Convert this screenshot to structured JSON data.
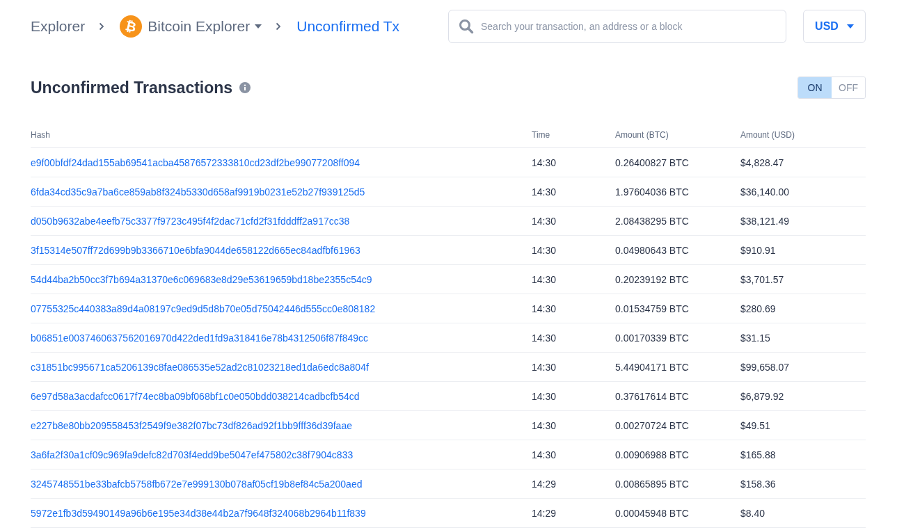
{
  "breadcrumb": [
    {
      "kind": "link",
      "label": "Explorer"
    },
    {
      "kind": "dropdown",
      "label": "Bitcoin Explorer",
      "logo": "₿"
    },
    {
      "kind": "current",
      "label": "Unconfirmed Tx"
    }
  ],
  "search": {
    "placeholder": "Search your transaction, an address or a block"
  },
  "currency": {
    "label": "USD"
  },
  "title": "Unconfirmed Transactions",
  "toggle": [
    {
      "label": "ON",
      "selected": true
    },
    {
      "label": "OFF",
      "selected": false
    }
  ],
  "table": {
    "columns": [
      "Hash",
      "Time",
      "Amount (BTC)",
      "Amount (USD)"
    ],
    "rows": [
      [
        "e9f00bfdf24dad155ab69541acba45876572333810cd23df2be99077208ff094",
        "14:30",
        "0.26400827 BTC",
        "$4,828.47"
      ],
      [
        "6fda34cd35c9a7ba6ce859ab8f324b5330d658af9919b0231e52b27f939125d5",
        "14:30",
        "1.97604036 BTC",
        "$36,140.00"
      ],
      [
        "d050b9632abe4eefb75c3377f9723c495f4f2dac71cfd2f31fdddff2a917cc38",
        "14:30",
        "2.08438295 BTC",
        "$38,121.49"
      ],
      [
        "3f15314e507ff72d699b9b3366710e6bfa9044de658122d665ec84adfbf61963",
        "14:30",
        "0.04980643 BTC",
        "$910.91"
      ],
      [
        "54d44ba2b50cc3f7b694a31370e6c069683e8d29e53619659bd18be2355c54c9",
        "14:30",
        "0.20239192 BTC",
        "$3,701.57"
      ],
      [
        "07755325c440383a89d4a08197c9ed9d5d8b70e05d75042446d555cc0e808182",
        "14:30",
        "0.01534759 BTC",
        "$280.69"
      ],
      [
        "b06851e0037460637562016970d422ded1fd9a318416e78b4312506f87f849cc",
        "14:30",
        "0.00170339 BTC",
        "$31.15"
      ],
      [
        "c31851bc995671ca5206139c8fae086535e52ad2c81023218ed1da6edc8a804f",
        "14:30",
        "5.44904171 BTC",
        "$99,658.07"
      ],
      [
        "6e97d58a3acdafcc0617f74ec8ba09bf068bf1c0e050bdd038214cadbcfb54cd",
        "14:30",
        "0.37617614 BTC",
        "$6,879.92"
      ],
      [
        "e227b8e80bb209558453f2549f9e382f07bc73df826ad92f1bb9fff36d39faae",
        "14:30",
        "0.00270724 BTC",
        "$49.51"
      ],
      [
        "3a6fa2f30a1cf09c969fa9defc82d703f4edd9be5047ef475802c38f7904c833",
        "14:30",
        "0.00906988 BTC",
        "$165.88"
      ],
      [
        "3245748551be33bafcb5758fb672e7e999130b078af05cf19b8ef84c5a200aed",
        "14:29",
        "0.00865895 BTC",
        "$158.36"
      ],
      [
        "5972e1fb3d59490149a96b6e195e34d38e44b2a7f9648f324068b2964b11f839",
        "14:29",
        "0.00045948 BTC",
        "$8.40"
      ]
    ]
  }
}
